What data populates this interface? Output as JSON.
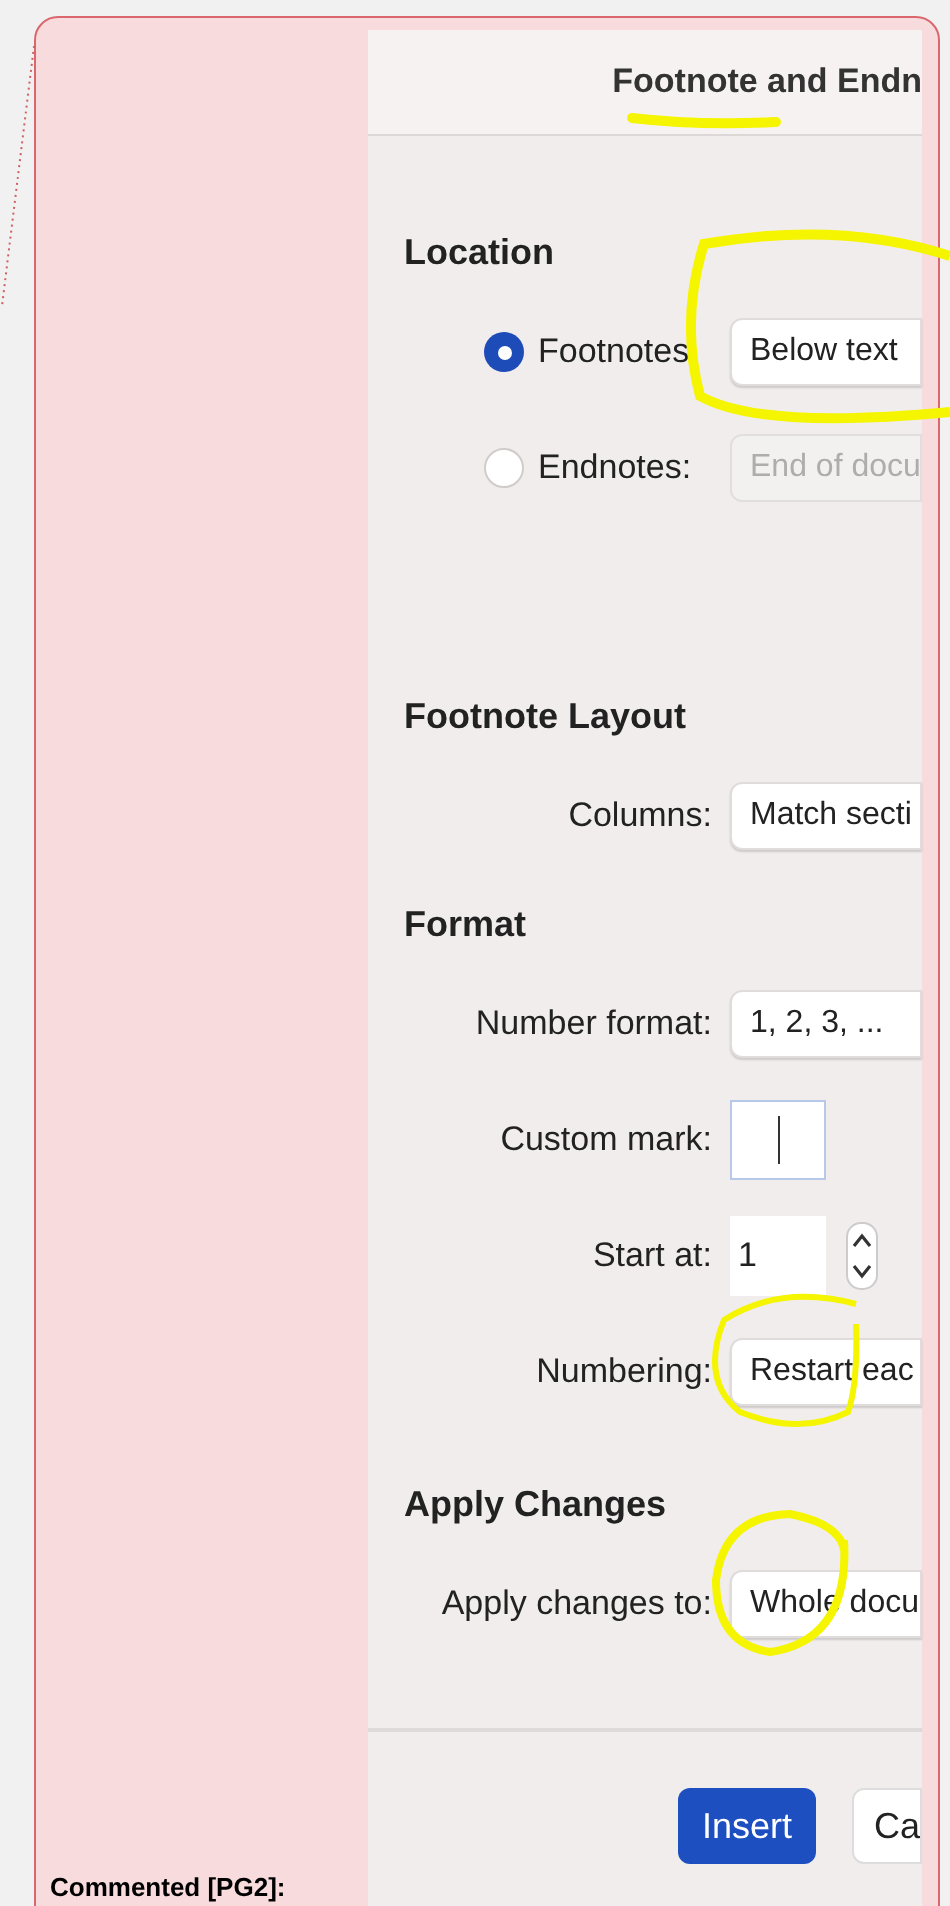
{
  "comment": {
    "label": "Commented [PG2]:"
  },
  "dialog": {
    "title": "Footnote and Endn",
    "sections": [
      {
        "heading": "Location",
        "rows": [
          {
            "kind": "radio",
            "label": "Footnotes",
            "selected": true,
            "value": "Below text",
            "disabled": false
          },
          {
            "kind": "radio",
            "label": "Endnotes:",
            "selected": false,
            "value": "End of docu",
            "disabled": true
          }
        ]
      },
      {
        "heading": "Footnote Layout",
        "rows": [
          {
            "kind": "select",
            "label": "Columns:",
            "value": "Match secti"
          }
        ]
      },
      {
        "heading": "Format",
        "rows": [
          {
            "kind": "select",
            "label": "Number format:",
            "value": "1, 2, 3, ..."
          },
          {
            "kind": "text_input",
            "label": "Custom mark:",
            "value": ""
          },
          {
            "kind": "stepper",
            "label": "Start at:",
            "value": "1"
          },
          {
            "kind": "select",
            "label": "Numbering:",
            "value": "Restart eac"
          }
        ]
      },
      {
        "heading": "Apply Changes",
        "rows": [
          {
            "kind": "select",
            "label": "Apply changes to:",
            "value": "Whole docu"
          }
        ]
      }
    ],
    "buttons": [
      {
        "label": "Insert",
        "primary": true
      },
      {
        "label": "Ca",
        "primary": false
      }
    ]
  }
}
